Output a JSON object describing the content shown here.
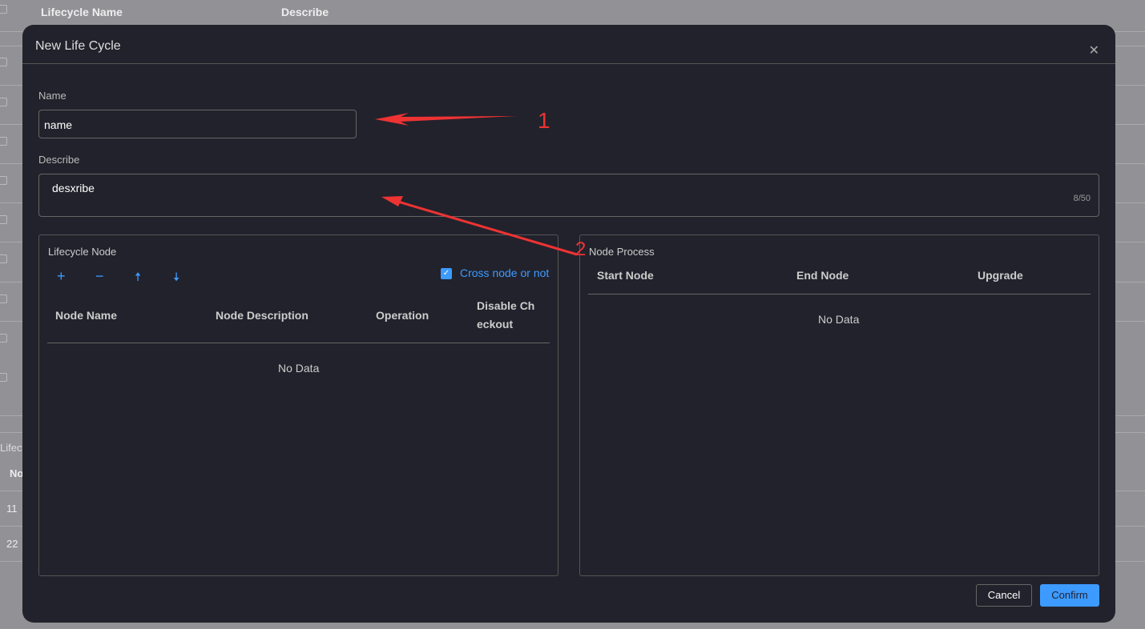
{
  "background": {
    "headers": [
      "Lifecycle Name",
      "Describe"
    ],
    "section_label": "Lifecy",
    "column_label": "No",
    "rows": [
      "11",
      "22"
    ]
  },
  "modal": {
    "title": "New Life Cycle",
    "close_icon": "close-icon",
    "name": {
      "label": "Name",
      "value": "name"
    },
    "describe": {
      "label": "Describe",
      "value": "desxribe",
      "count": "8/50"
    },
    "lifecycle_node": {
      "title": "Lifecycle Node",
      "tools": [
        "plus-icon",
        "minus-icon",
        "arrow-up-icon",
        "arrow-down-icon"
      ],
      "cross_node": {
        "label": "Cross node or not",
        "checked": true
      },
      "columns": [
        "Node Name",
        "Node Description",
        "Operation",
        "Disable Ch eckout"
      ],
      "empty": "No Data"
    },
    "node_process": {
      "title": "Node Process",
      "columns": [
        "Start Node",
        "End Node",
        "Upgrade"
      ],
      "empty": "No Data"
    },
    "cancel": "Cancel",
    "confirm": "Confirm"
  },
  "annotations": [
    "1",
    "2"
  ],
  "colors": {
    "accent": "#3d9bff",
    "annotation": "#ee3333",
    "modal_bg": "#22222c"
  }
}
